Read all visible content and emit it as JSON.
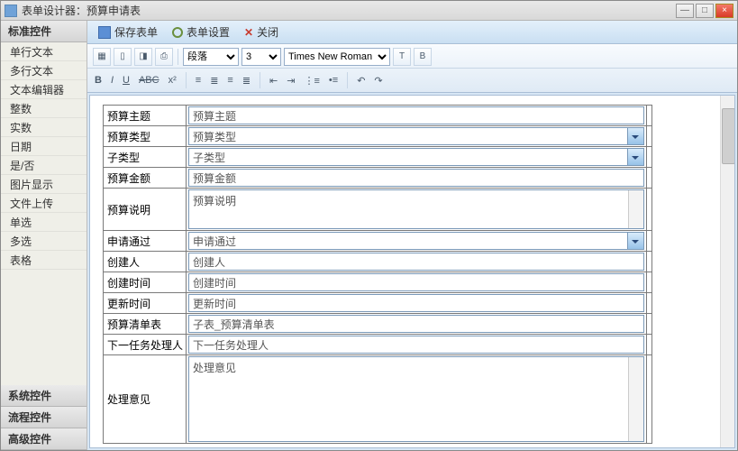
{
  "window": {
    "title": "表单设计器：预算申请表"
  },
  "winbtns": {
    "min": "—",
    "max": "□",
    "close": "×"
  },
  "sidebar": {
    "section1": "标准控件",
    "items": [
      "单行文本",
      "多行文本",
      "文本编辑器",
      "整数",
      "实数",
      "日期",
      "是/否",
      "图片显示",
      "文件上传",
      "单选",
      "多选",
      "表格"
    ],
    "section2": "系统控件",
    "section3": "流程控件",
    "section4": "高级控件"
  },
  "toolbar": {
    "save": "保存表单",
    "settings": "表单设置",
    "close": "关闭"
  },
  "editor": {
    "format_sel": "段落",
    "size_sel": "3",
    "font_sel": "Times New Roman",
    "b": "B",
    "i": "I",
    "u": "U",
    "abc": "ABC",
    "x2": "x²"
  },
  "form": {
    "rows": [
      {
        "label": "预算主题",
        "value": "预算主题",
        "type": "text"
      },
      {
        "label": "预算类型",
        "value": "预算类型",
        "type": "select"
      },
      {
        "label": "子类型",
        "value": "子类型",
        "type": "select"
      },
      {
        "label": "预算金额",
        "value": "预算金额",
        "type": "text"
      },
      {
        "label": "预算说明",
        "value": "预算说明",
        "type": "textarea"
      },
      {
        "label": "申请通过",
        "value": "申请通过",
        "type": "select"
      },
      {
        "label": "创建人",
        "value": "创建人",
        "type": "text"
      },
      {
        "label": "创建时间",
        "value": "创建时间",
        "type": "text"
      },
      {
        "label": "更新时间",
        "value": "更新时间",
        "type": "text"
      },
      {
        "label": "预算清单表",
        "value": "子表_预算清单表",
        "type": "text"
      },
      {
        "label": "下一任务处理人",
        "value": "下一任务处理人",
        "type": "text"
      },
      {
        "label": "处理意见",
        "value": "处理意见",
        "type": "textarea-big"
      }
    ]
  }
}
